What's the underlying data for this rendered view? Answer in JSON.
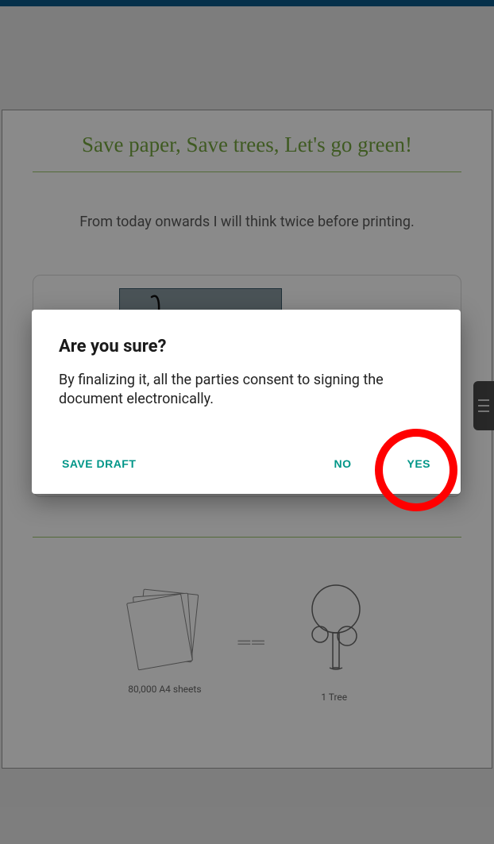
{
  "page": {
    "headline": "Save paper, Save trees, Let's go green!",
    "subhead": "From today onwards I will think twice before printing.",
    "footer": {
      "sheets_caption": "80,000 A4 sheets",
      "equals": "══",
      "tree_caption": "1 Tree"
    }
  },
  "dialog": {
    "title": "Are you sure?",
    "body": "By finalizing it, all the parties consent to signing the document electronically.",
    "actions": {
      "save_draft": "SAVE DRAFT",
      "no": "NO",
      "yes": "YES"
    }
  },
  "colors": {
    "accent_green": "#75a73f",
    "teal": "#009688",
    "topbar": "#0a5a8a",
    "highlight": "#ff0000"
  }
}
